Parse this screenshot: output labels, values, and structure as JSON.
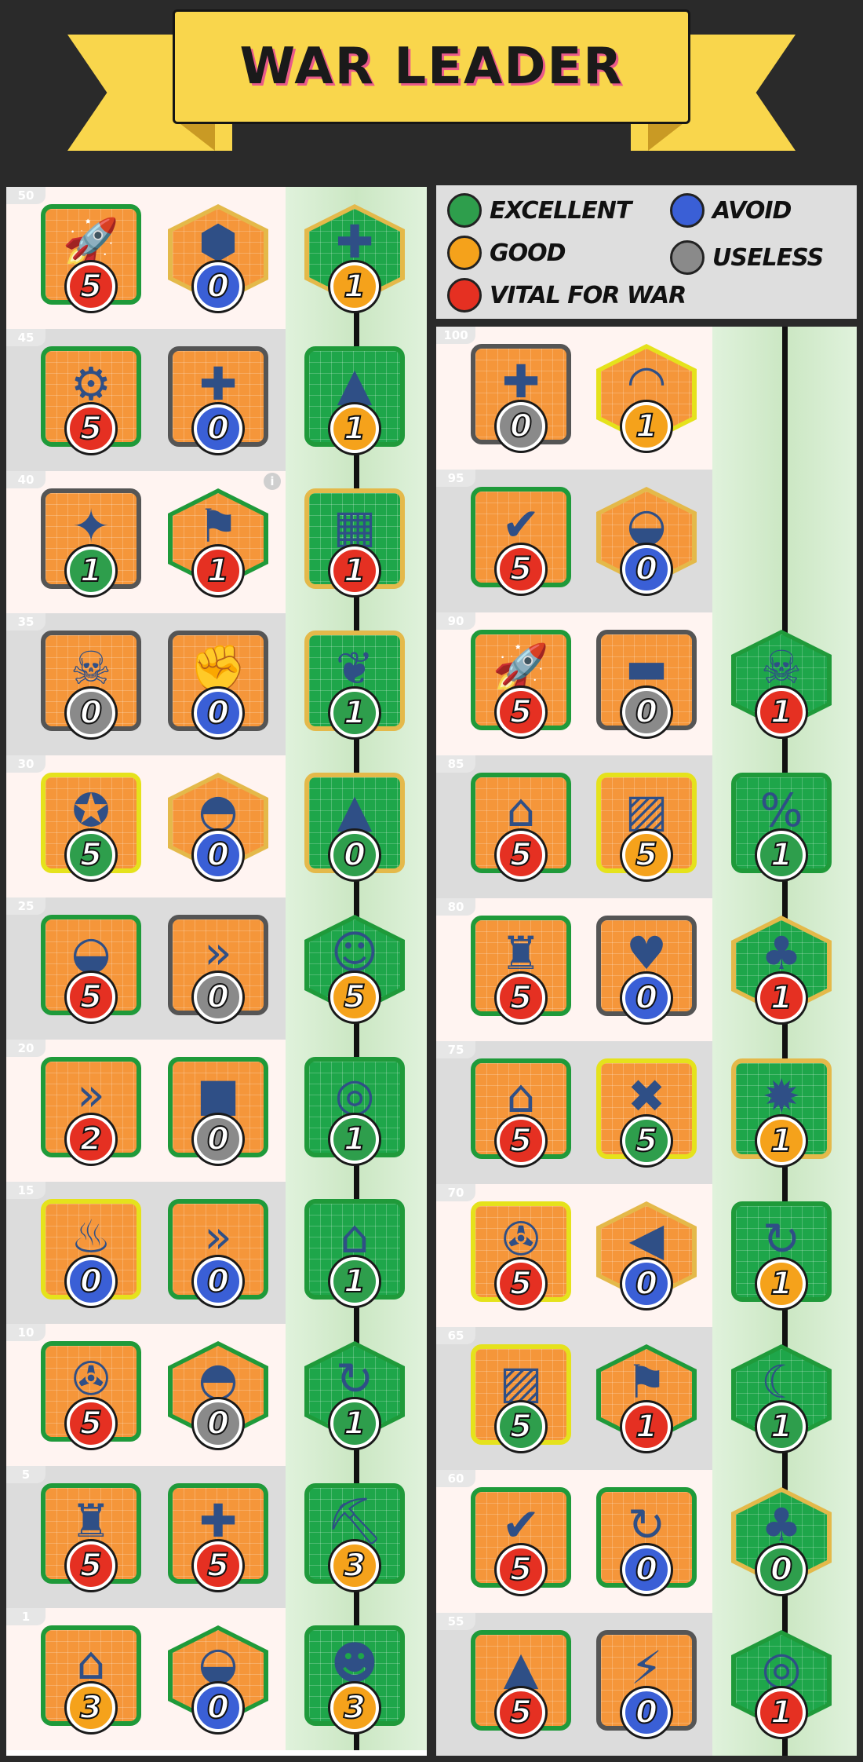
{
  "title": "WAR LEADER",
  "legend": [
    {
      "label": "EXCELLENT",
      "color": "#2e9e4c"
    },
    {
      "label": "AVOID",
      "color": "#3a5fd6"
    },
    {
      "label": "GOOD",
      "color": "#f5a21b"
    },
    {
      "label": "USELESS",
      "color": "#8a8a8a"
    },
    {
      "label": "VITAL FOR WAR",
      "color": "#e53022"
    }
  ],
  "left_tree": [
    {
      "level": "50",
      "cards": [
        {
          "icon": "missile-icon",
          "shape": "square",
          "border": "green",
          "value": "5",
          "rating": "red"
        },
        {
          "icon": "landmine-icon",
          "shape": "hex",
          "border": "gold",
          "value": "0",
          "rating": "blue"
        },
        {
          "icon": "golden-mask-plus-icon",
          "shape": "hex",
          "border": "gold",
          "value": "1",
          "rating": "orange"
        }
      ]
    },
    {
      "level": "45",
      "cards": [
        {
          "icon": "gear-shield-icon",
          "shape": "square",
          "border": "green",
          "value": "5",
          "rating": "red"
        },
        {
          "icon": "helmet-heal-icon",
          "shape": "square",
          "border": "grey",
          "value": "0",
          "rating": "blue"
        },
        {
          "icon": "hq-mask-icon",
          "shape": "square",
          "border": "green",
          "value": "1",
          "rating": "orange"
        }
      ]
    },
    {
      "level": "40",
      "info": true,
      "cards": [
        {
          "icon": "laser-gun-icon",
          "shape": "square",
          "border": "grey",
          "value": "1",
          "rating": "green"
        },
        {
          "icon": "flag-icon",
          "shape": "hex",
          "border": "green",
          "value": "1",
          "rating": "red"
        },
        {
          "icon": "wall-mask-icon",
          "shape": "square",
          "border": "gold",
          "value": "1",
          "rating": "red"
        }
      ]
    },
    {
      "level": "35",
      "cards": [
        {
          "icon": "skull-shield-icon",
          "shape": "square",
          "border": "grey",
          "value": "0",
          "rating": "grey"
        },
        {
          "icon": "muscle-shield-icon",
          "shape": "square",
          "border": "grey",
          "value": "0",
          "rating": "blue"
        },
        {
          "icon": "leaf-up-icon",
          "shape": "square",
          "border": "gold",
          "value": "1",
          "rating": "green"
        }
      ]
    },
    {
      "level": "30",
      "cards": [
        {
          "icon": "soldier-medal-icon",
          "shape": "square",
          "border": "yellow",
          "value": "5",
          "rating": "green"
        },
        {
          "icon": "goggle-helmet-icon",
          "shape": "hex",
          "border": "gold",
          "value": "0",
          "rating": "blue"
        },
        {
          "icon": "building-up-icon",
          "shape": "square",
          "border": "gold",
          "value": "0",
          "rating": "green"
        }
      ]
    },
    {
      "level": "25",
      "cards": [
        {
          "icon": "army-helmet-icon",
          "shape": "square",
          "border": "green",
          "value": "5",
          "rating": "red"
        },
        {
          "icon": "double-chevron-icon",
          "shape": "square",
          "border": "grey",
          "value": "0",
          "rating": "grey"
        },
        {
          "icon": "commander-portrait-icon",
          "shape": "hex",
          "border": "green",
          "value": "5",
          "rating": "orange"
        }
      ]
    },
    {
      "level": "20",
      "cards": [
        {
          "icon": "helmet-speed-icon",
          "shape": "square",
          "border": "green",
          "value": "2",
          "rating": "red"
        },
        {
          "icon": "gift-box-icon",
          "shape": "square",
          "border": "green",
          "value": "0",
          "rating": "grey"
        },
        {
          "icon": "target-mask-icon",
          "shape": "square",
          "border": "green",
          "value": "1",
          "rating": "green"
        }
      ]
    },
    {
      "level": "15",
      "cards": [
        {
          "icon": "fire-icon",
          "shape": "square",
          "border": "yellow",
          "value": "0",
          "rating": "blue"
        },
        {
          "icon": "helmets-speed-icon",
          "shape": "square",
          "border": "green",
          "value": "0",
          "rating": "blue"
        },
        {
          "icon": "free-build-icon",
          "shape": "square",
          "border": "green",
          "value": "1",
          "rating": "green"
        }
      ]
    },
    {
      "level": "10",
      "cards": [
        {
          "icon": "soldier-robot-icon",
          "shape": "square",
          "border": "green",
          "value": "5",
          "rating": "red"
        },
        {
          "icon": "blue-helmet-icon",
          "shape": "hex",
          "border": "green",
          "value": "0",
          "rating": "grey"
        },
        {
          "icon": "refresh-2-icon",
          "shape": "hex",
          "border": "green",
          "value": "1",
          "rating": "green"
        }
      ]
    },
    {
      "level": "5",
      "cards": [
        {
          "icon": "tower-icon",
          "shape": "square",
          "border": "green",
          "value": "5",
          "rating": "red"
        },
        {
          "icon": "medkit-icon",
          "shape": "square",
          "border": "green",
          "value": "5",
          "rating": "red"
        },
        {
          "icon": "pickaxe-exp-icon",
          "shape": "square",
          "border": "green",
          "value": "3",
          "rating": "orange"
        }
      ]
    },
    {
      "level": "1",
      "cards": [
        {
          "icon": "house-icon",
          "shape": "square",
          "border": "green",
          "value": "3",
          "rating": "orange"
        },
        {
          "icon": "army-helmet-icon",
          "shape": "hex",
          "border": "green",
          "value": "0",
          "rating": "blue"
        },
        {
          "icon": "zombie-exp-icon",
          "shape": "square",
          "border": "green",
          "value": "3",
          "rating": "orange"
        }
      ]
    }
  ],
  "right_tree": [
    {
      "level": "100",
      "cards": [
        {
          "icon": "helmet-heal-icon",
          "shape": "square",
          "border": "grey",
          "value": "0",
          "rating": "grey"
        },
        {
          "icon": "mask-icon",
          "shape": "hex",
          "border": "yellow",
          "value": "1",
          "rating": "orange"
        }
      ]
    },
    {
      "level": "95",
      "cards": [
        {
          "icon": "check-shield-icon",
          "shape": "square",
          "border": "green",
          "value": "5",
          "rating": "red"
        },
        {
          "icon": "army-helmet-icon",
          "shape": "hex",
          "border": "gold",
          "value": "0",
          "rating": "blue"
        }
      ]
    },
    {
      "level": "90",
      "cards": [
        {
          "icon": "missile-icon",
          "shape": "square",
          "border": "green",
          "value": "5",
          "rating": "red"
        },
        {
          "icon": "truck-shield-icon",
          "shape": "square",
          "border": "grey",
          "value": "0",
          "rating": "grey"
        },
        {
          "icon": "demon-skull-icon",
          "shape": "hex",
          "border": "green",
          "value": "1",
          "rating": "red"
        }
      ]
    },
    {
      "level": "85",
      "cards": [
        {
          "icon": "hq-speed-icon",
          "shape": "square",
          "border": "green",
          "value": "5",
          "rating": "red"
        },
        {
          "icon": "rubble-icon",
          "shape": "square",
          "border": "yellow",
          "value": "5",
          "rating": "orange"
        },
        {
          "icon": "discount-ticket-icon",
          "shape": "square",
          "border": "green",
          "value": "1",
          "rating": "green"
        }
      ]
    },
    {
      "level": "80",
      "cards": [
        {
          "icon": "tower-up-icon",
          "shape": "square",
          "border": "green",
          "value": "5",
          "rating": "red"
        },
        {
          "icon": "heart-plus-icon",
          "shape": "square",
          "border": "grey",
          "value": "0",
          "rating": "blue"
        },
        {
          "icon": "palm-tree-icon",
          "shape": "hex",
          "border": "gold",
          "value": "1",
          "rating": "red"
        }
      ]
    },
    {
      "level": "75",
      "cards": [
        {
          "icon": "hq-speed-icon",
          "shape": "square",
          "border": "green",
          "value": "5",
          "rating": "red"
        },
        {
          "icon": "versus-up-icon",
          "shape": "square",
          "border": "yellow",
          "value": "5",
          "rating": "green"
        },
        {
          "icon": "explosion-mask-icon",
          "shape": "square",
          "border": "gold",
          "value": "1",
          "rating": "orange"
        }
      ]
    },
    {
      "level": "70",
      "cards": [
        {
          "icon": "cannon-icon",
          "shape": "square",
          "border": "yellow",
          "value": "5",
          "rating": "red"
        },
        {
          "icon": "megaphone-icon",
          "shape": "hex",
          "border": "gold",
          "value": "0",
          "rating": "blue"
        },
        {
          "icon": "mask-refresh-icon",
          "shape": "square",
          "border": "green",
          "value": "1",
          "rating": "orange"
        }
      ]
    },
    {
      "level": "65",
      "cards": [
        {
          "icon": "rubble-icon",
          "shape": "square",
          "border": "yellow",
          "value": "5",
          "rating": "green"
        },
        {
          "icon": "flag-up-icon",
          "shape": "hex",
          "border": "green",
          "value": "1",
          "rating": "red"
        },
        {
          "icon": "horns-icon",
          "shape": "hex",
          "border": "green",
          "value": "1",
          "rating": "green"
        }
      ]
    },
    {
      "level": "60",
      "cards": [
        {
          "icon": "check-shield-icon",
          "shape": "square",
          "border": "green",
          "value": "5",
          "rating": "red"
        },
        {
          "icon": "helmet-refresh-icon",
          "shape": "square",
          "border": "green",
          "value": "0",
          "rating": "blue"
        },
        {
          "icon": "bush-icon",
          "shape": "hex",
          "border": "gold",
          "value": "0",
          "rating": "green"
        }
      ]
    },
    {
      "level": "55",
      "cards": [
        {
          "icon": "soldier-up-icon",
          "shape": "square",
          "border": "green",
          "value": "5",
          "rating": "red"
        },
        {
          "icon": "soldier-boost-icon",
          "shape": "square",
          "border": "grey",
          "value": "0",
          "rating": "blue"
        },
        {
          "icon": "whirlwind-icon",
          "shape": "hex",
          "border": "green",
          "value": "1",
          "rating": "red"
        }
      ]
    }
  ]
}
